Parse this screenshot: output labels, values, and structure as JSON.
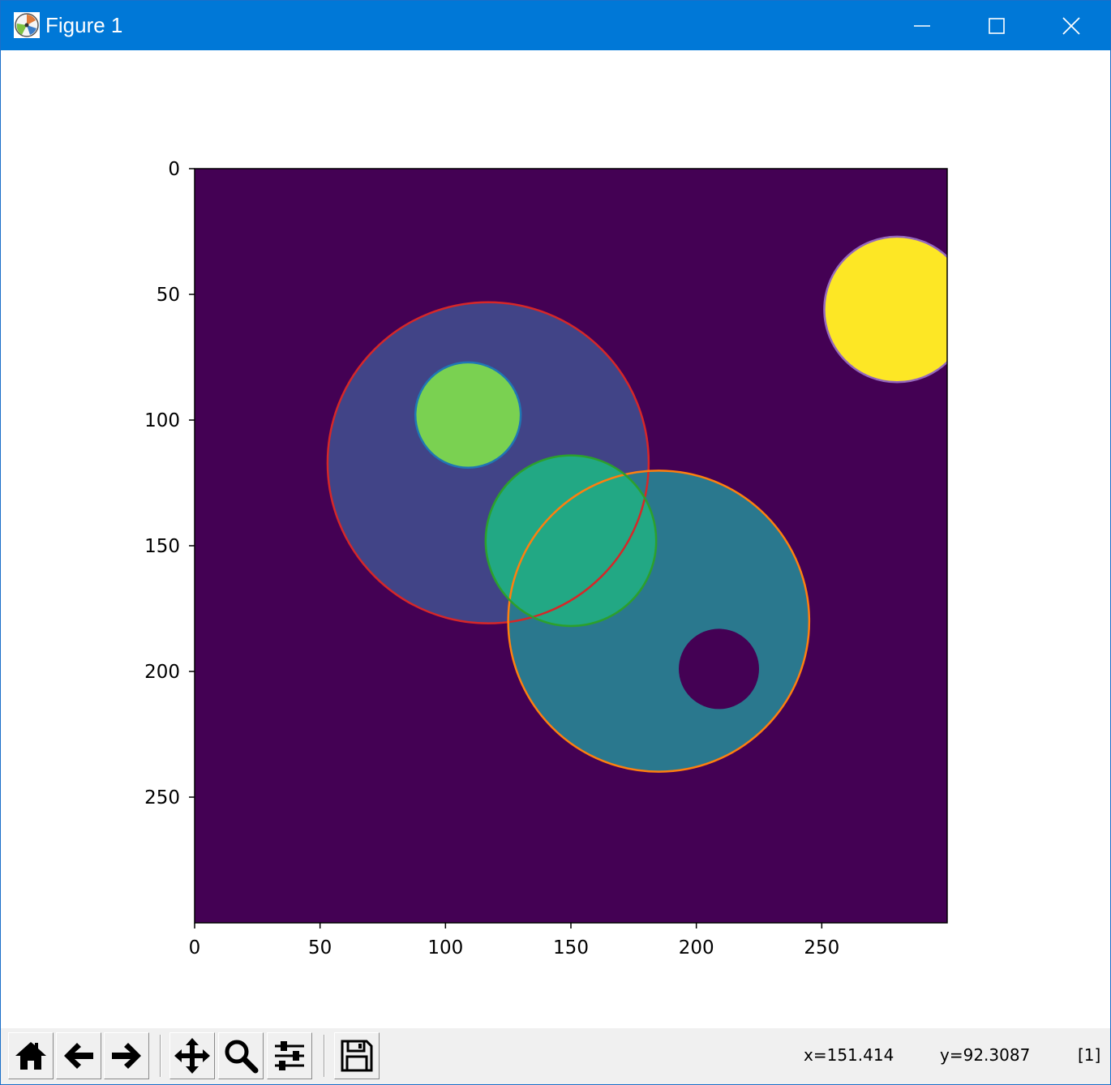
{
  "window": {
    "title": "Figure 1",
    "app_icon": "matplotlib-icon",
    "controls": [
      "minimize-icon",
      "maximize-icon",
      "close-icon"
    ],
    "titlebar_color": "#0078d7"
  },
  "toolbar": {
    "buttons": [
      {
        "name": "home-icon",
        "tooltip": "Home"
      },
      {
        "name": "back-arrow-icon",
        "tooltip": "Back"
      },
      {
        "name": "forward-arrow-icon",
        "tooltip": "Forward"
      },
      {
        "name": "pan-move-icon",
        "tooltip": "Pan"
      },
      {
        "name": "zoom-magnifier-icon",
        "tooltip": "Zoom"
      },
      {
        "name": "subplots-sliders-icon",
        "tooltip": "Subplots"
      },
      {
        "name": "save-disk-icon",
        "tooltip": "Save"
      }
    ]
  },
  "status": {
    "x_readout": "x=151.414",
    "y_readout": "y=92.3087",
    "value_readout": "[1]"
  },
  "chart_data": {
    "type": "heatmap",
    "title": "",
    "xlabel": "",
    "ylabel": "",
    "xlim": [
      0,
      300
    ],
    "ylim": [
      300,
      0
    ],
    "x_ticks": [
      "0",
      "50",
      "100",
      "150",
      "200",
      "250"
    ],
    "y_ticks": [
      "0",
      "50",
      "100",
      "150",
      "200",
      "250"
    ],
    "x_tick_values": [
      0,
      50,
      100,
      150,
      200,
      250
    ],
    "y_tick_values": [
      0,
      50,
      100,
      150,
      200,
      250
    ],
    "colormap": "viridis",
    "background_color": "#440154",
    "regions": [
      {
        "label": 1,
        "shape": "circle",
        "cx": 117,
        "cy": 117,
        "r": 64,
        "color": "#414487",
        "contour_color": "#d62728"
      },
      {
        "label": 2,
        "shape": "circle",
        "cx": 185,
        "cy": 180,
        "r": 60,
        "color": "#2a788e",
        "contour_color": "#ff7f0e"
      },
      {
        "label": 3,
        "shape": "circle",
        "cx": 150,
        "cy": 148,
        "r": 34,
        "color": "#22a884",
        "contour_color": "#2ca02c"
      },
      {
        "label": 4,
        "shape": "circle",
        "cx": 109,
        "cy": 98,
        "r": 21,
        "color": "#7ad151",
        "contour_color": "#1f77b4"
      },
      {
        "label": 5,
        "shape": "circle",
        "cx": 280,
        "cy": 56,
        "r": 29,
        "color": "#fde725",
        "contour_color": "#9467bd"
      },
      {
        "label": 0,
        "shape": "circle-hole",
        "cx": 209,
        "cy": 199,
        "r": 16,
        "color": "#440154",
        "contour_color": "none"
      }
    ]
  }
}
